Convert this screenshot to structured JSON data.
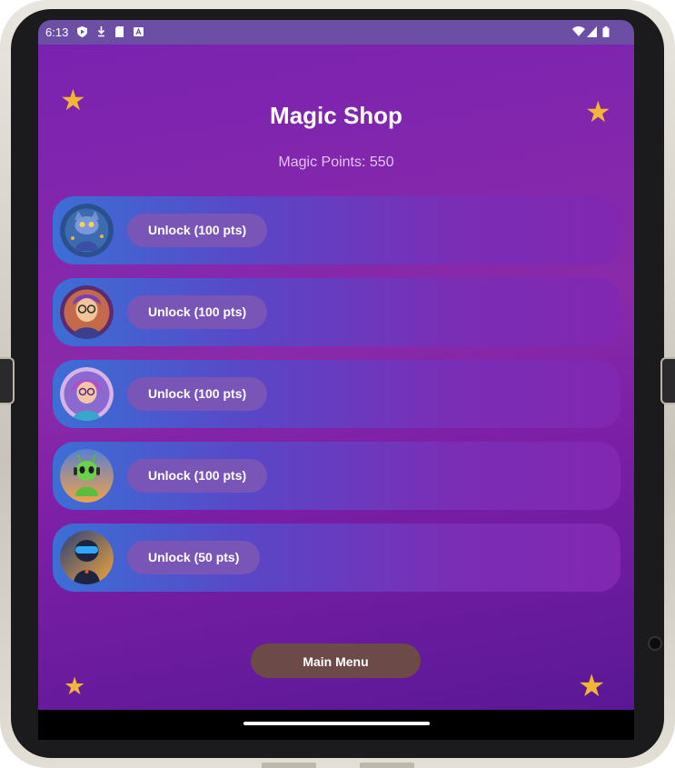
{
  "status_bar": {
    "time": "6:13",
    "icons": [
      "shield-icon",
      "download-icon",
      "sd-card-icon",
      "font-a-icon",
      "wifi-icon",
      "signal-icon",
      "battery-icon"
    ]
  },
  "shop": {
    "title": "Magic Shop",
    "points_label": "Magic Points: 550"
  },
  "items": [
    {
      "avatar": "cat-wizard-avatar",
      "button_label": "Unlock (100 pts)"
    },
    {
      "avatar": "boy-glasses-avatar",
      "button_label": "Unlock (100 pts)"
    },
    {
      "avatar": "girl-glasses-avatar",
      "button_label": "Unlock (100 pts)"
    },
    {
      "avatar": "alien-headset-avatar",
      "button_label": "Unlock (100 pts)"
    },
    {
      "avatar": "robot-visor-avatar",
      "button_label": "Unlock (50 pts)"
    }
  ],
  "footer": {
    "main_menu_label": "Main Menu"
  },
  "colors": {
    "background": "#7a22b0",
    "star": "#f2b536",
    "unlock_button": "#7a55b8",
    "main_menu_button": "#6b4a48"
  }
}
